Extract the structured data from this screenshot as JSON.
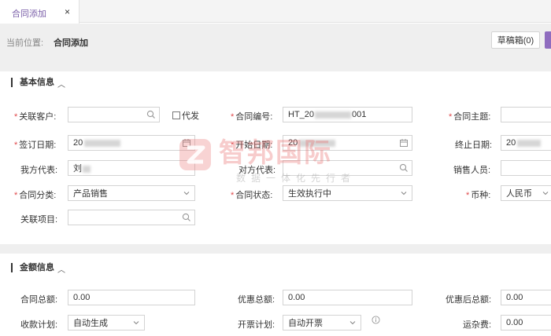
{
  "tab": {
    "label": "合同添加",
    "close": "×"
  },
  "location": {
    "label": "当前位置:",
    "value": "合同添加"
  },
  "toolbar": {
    "draft_label": "草稿箱(0)"
  },
  "basic": {
    "title": "基本信息",
    "fields": {
      "customer": {
        "label": "关联客户:",
        "value": "",
        "required": "*"
      },
      "proxy": {
        "label": "代发"
      },
      "contract_no": {
        "label": "合同编号:",
        "value_prefix": "HT_20",
        "value_suffix": "001",
        "required": "*"
      },
      "subject": {
        "label": "合同主题:",
        "value": "",
        "required": "*"
      },
      "sign_date": {
        "label": "签订日期:",
        "value": "20",
        "required": "*"
      },
      "start_date": {
        "label": "开始日期:",
        "value": "20",
        "required": "*"
      },
      "end_date": {
        "label": "终止日期:",
        "value": "20"
      },
      "our_rep": {
        "label": "我方代表:",
        "value": "刘"
      },
      "their_rep": {
        "label": "对方代表:",
        "value": ""
      },
      "salesperson": {
        "label": "销售人员:",
        "value": ""
      },
      "category": {
        "label": "合同分类:",
        "value": "产品销售",
        "required": "*"
      },
      "status": {
        "label": "合同状态:",
        "value": "生效执行中",
        "required": "*"
      },
      "currency": {
        "label": "币种:",
        "value": "人民币",
        "required": "*"
      },
      "project": {
        "label": "关联项目:",
        "value": ""
      }
    }
  },
  "amount": {
    "title": "金额信息",
    "fields": {
      "total": {
        "label": "合同总额:",
        "value": "0.00"
      },
      "discount": {
        "label": "优惠总额:",
        "value": "0.00"
      },
      "after_discount": {
        "label": "优惠后总额:",
        "value": "0.00"
      },
      "payment_plan": {
        "label": "收款计划:",
        "value": "自动生成"
      },
      "invoice_plan": {
        "label": "开票计划:",
        "value": "自动开票"
      },
      "misc_fee": {
        "label": "运杂费:",
        "value": "0.00"
      }
    }
  },
  "watermark": {
    "title": "智邦国际",
    "subtitle": "数据一体化先行者"
  },
  "colors": {
    "accent": "#8f6cbf",
    "required": "#e0484b",
    "watermark": "#e86e6e"
  }
}
